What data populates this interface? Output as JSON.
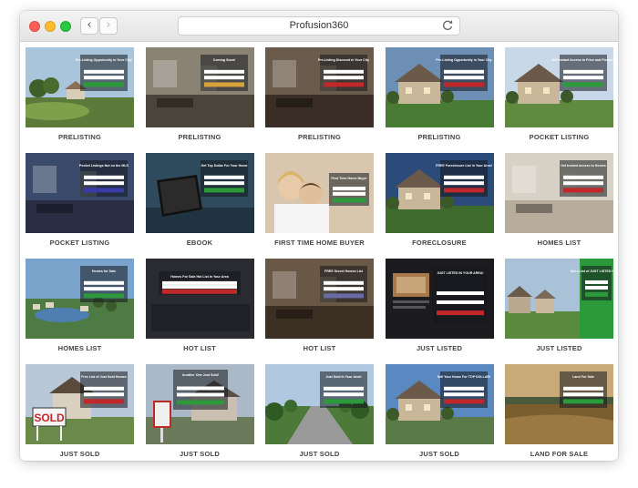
{
  "window": {
    "title": "Profusion360"
  },
  "templates": [
    {
      "label": "PRELISTING",
      "scene": "golf",
      "panel": "Pre-Listing Opportunity in Your City!",
      "sky": "#a8c5dc",
      "ground": "#5c7a3a",
      "accent": "#2c9a3a"
    },
    {
      "label": "PRELISTING",
      "scene": "interior",
      "panel": "Coming Soon!",
      "sky": "#8a8374",
      "ground": "#4a443b",
      "accent": "#d8a23a"
    },
    {
      "label": "PRELISTING",
      "scene": "interior",
      "panel": "Pre-Listing Discount in Your City",
      "sky": "#6b5b4d",
      "ground": "#3a2e26",
      "accent": "#c0282a"
    },
    {
      "label": "PRELISTING",
      "scene": "house",
      "panel": "Pre-Listing Opportunity in Your City",
      "sky": "#6d8eb5",
      "ground": "#4a7b35",
      "accent": "#c0282a"
    },
    {
      "label": "POCKET LISTING",
      "scene": "house",
      "panel": "Get Instant Access to Price and Pictures",
      "sky": "#c9d8e8",
      "ground": "#5f8a3f",
      "accent": "#2c9a3a"
    },
    {
      "label": "POCKET LISTING",
      "scene": "interior",
      "panel": "Pocket Listings Not on the MLS",
      "sky": "#3a4a6a",
      "ground": "#2a2e44",
      "accent": "#3a3aa8"
    },
    {
      "label": "EBOOK",
      "scene": "tablet",
      "panel": "Get Top Dollar For Your Home",
      "sky": "#2e4a5c",
      "ground": "#1f3340",
      "accent": "#2c9a3a"
    },
    {
      "label": "FIRST TIME HOME BUYER",
      "scene": "couple",
      "panel": "First Time Home Buyer",
      "sky": "#c8b7a0",
      "ground": "#8a7a66",
      "accent": "#2c9a3a"
    },
    {
      "label": "FORECLOSURE",
      "scene": "house",
      "panel": "FREE Foreclosure List in Your Area!",
      "sky": "#2c4a7a",
      "ground": "#3e6b2e",
      "accent": "#c0282a"
    },
    {
      "label": "HOMES LIST",
      "scene": "interior",
      "panel": "Get Instant Access to Homes",
      "sky": "#d8d2c6",
      "ground": "#b8ad9c",
      "accent": "#c0282a"
    },
    {
      "label": "HOMES LIST",
      "scene": "aerial",
      "panel": "Homes for Sale",
      "sky": "#7ba4cc",
      "ground": "#4e7a44",
      "accent": "#2c9a3a"
    },
    {
      "label": "HOT LIST",
      "scene": "dark",
      "panel": "Homes For Sale Hot List In Your Area",
      "sky": "#2a2a2e",
      "ground": "#1a1a1e",
      "accent": "#c0282a"
    },
    {
      "label": "HOT LIST",
      "scene": "interior",
      "panel": "FREE Secret Homes List",
      "sky": "#6a5846",
      "ground": "#3c2f24",
      "accent": "#6a6aa8"
    },
    {
      "label": "JUST LISTED",
      "scene": "listing",
      "panel": "JUST LISTED IN YOUR AREA!",
      "sky": "#1e1e22",
      "ground": "#141418",
      "accent": "#c0282a"
    },
    {
      "label": "JUST LISTED",
      "scene": "street",
      "panel": "Get a List of JUST LISTED Homes",
      "sky": "#a9c2d8",
      "ground": "#5a8a3e",
      "accent": "#2c9a3a"
    },
    {
      "label": "JUST SOLD",
      "scene": "sold",
      "panel": "Free List of Just Sold Homes",
      "sky": "#b8c8d8",
      "ground": "#6a8a4a",
      "accent": "#c0282a"
    },
    {
      "label": "JUST SOLD",
      "scene": "sold2",
      "panel": "Another One Just Sold!",
      "sky": "#aab8c8",
      "ground": "#6a7a5a",
      "accent": "#2c9a3a"
    },
    {
      "label": "JUST SOLD",
      "scene": "road",
      "panel": "Just Sold In Your Area!",
      "sky": "#b0c8e0",
      "ground": "#4d7a38",
      "accent": "#2c9a3a"
    },
    {
      "label": "JUST SOLD",
      "scene": "house",
      "panel": "Sell Your Home For TOP DOLLAR!",
      "sky": "#5a88c0",
      "ground": "#5a7a48",
      "accent": "#c0282a"
    },
    {
      "label": "LAND FOR SALE",
      "scene": "field",
      "panel": "Land For Sale",
      "sky": "#c9a978",
      "ground": "#8a6a3a",
      "accent": "#2c9a3a"
    }
  ]
}
